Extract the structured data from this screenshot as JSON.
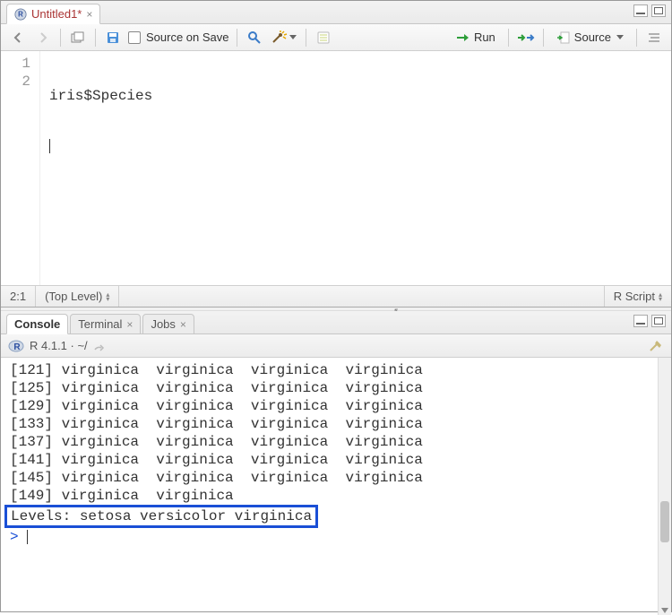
{
  "source": {
    "tab": {
      "title": "Untitled1*"
    },
    "toolbar": {
      "source_on_save": "Source on Save",
      "run": "Run",
      "source": "Source"
    },
    "gutter": [
      "1",
      "2"
    ],
    "code_line1": "iris$Species",
    "status": {
      "pos": "2:1",
      "scope": "(Top Level)",
      "lang": "R Script"
    }
  },
  "console": {
    "tabs": {
      "console": "Console",
      "terminal": "Terminal",
      "jobs": "Jobs"
    },
    "header": "R 4.1.1 · ~/",
    "rows": [
      {
        "idx": "[121]",
        "vals": [
          "virginica",
          "virginica",
          "virginica",
          "virginica"
        ]
      },
      {
        "idx": "[125]",
        "vals": [
          "virginica",
          "virginica",
          "virginica",
          "virginica"
        ]
      },
      {
        "idx": "[129]",
        "vals": [
          "virginica",
          "virginica",
          "virginica",
          "virginica"
        ]
      },
      {
        "idx": "[133]",
        "vals": [
          "virginica",
          "virginica",
          "virginica",
          "virginica"
        ]
      },
      {
        "idx": "[137]",
        "vals": [
          "virginica",
          "virginica",
          "virginica",
          "virginica"
        ]
      },
      {
        "idx": "[141]",
        "vals": [
          "virginica",
          "virginica",
          "virginica",
          "virginica"
        ]
      },
      {
        "idx": "[145]",
        "vals": [
          "virginica",
          "virginica",
          "virginica",
          "virginica"
        ]
      },
      {
        "idx": "[149]",
        "vals": [
          "virginica",
          "virginica"
        ]
      }
    ],
    "levels": "Levels: setosa versicolor virginica",
    "prompt": ">"
  }
}
